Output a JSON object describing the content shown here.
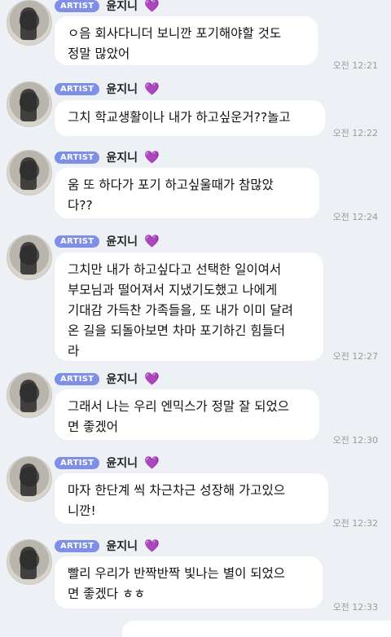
{
  "messages": [
    {
      "badge": "ARTIST",
      "name": "윤지니",
      "text": "ㅇ음 회사다니더 보니깐 포기해야할 것도\n정말 많았어",
      "time": "오전 12:21"
    },
    {
      "badge": "ARTIST",
      "name": "윤지니",
      "text": "그치 학교생활이나 내가 하고싶운거??놀고",
      "time": "오전 12:22"
    },
    {
      "badge": "ARTIST",
      "name": "윤지니",
      "text": "움 또 하다가 포기 하고싶울때가 참많았\n다??",
      "time": "오전 12:24"
    },
    {
      "badge": "ARTIST",
      "name": "윤지니",
      "text": " 그치만 내가 하고싶다고 선택한 일이여서\n부모님과 떨어져서 지냈기도했고 나에게\n기대감 가득찬 가족들을, 또 내가 이미 달려\n온 길을 되돌아보면 차마 포기하긴 힘들더\n라",
      "time": "오전 12:27"
    },
    {
      "badge": "ARTIST",
      "name": "윤지니",
      "text": "그래서 나는 우리 엔믹스가 정말 잘 되었으\n면 좋겠어",
      "time": "오전 12:30"
    },
    {
      "badge": "ARTIST",
      "name": "윤지니",
      "text": "  마자 한단계 씩 차근차근 성장해 가고있으\n니깐!",
      "time": "오전 12:32"
    },
    {
      "badge": "ARTIST",
      "name": "윤지니",
      "text": "빨리 우리가 반짝반짝 빛나는 별이 되었으\n면 좋겠다 ㅎㅎ",
      "time": "오전 12:33"
    }
  ],
  "heart_icon": "purple-heart-icon",
  "colors": {
    "background": "#edf0f4",
    "badge": "#7d8fe6",
    "heart": "#8a3ef2",
    "bubble": "#ffffff"
  }
}
